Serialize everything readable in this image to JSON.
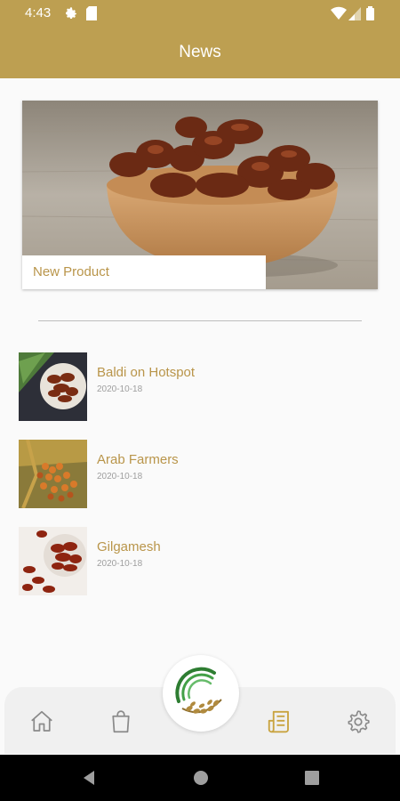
{
  "status_bar": {
    "time": "4:43"
  },
  "app_bar": {
    "title": "News"
  },
  "featured": {
    "caption": "New Product"
  },
  "news": [
    {
      "title": "Baldi on Hotspot",
      "date": "2020-10-18"
    },
    {
      "title": "Arab Farmers",
      "date": "2020-10-18"
    },
    {
      "title": "Gilgamesh",
      "date": "2020-10-18"
    }
  ],
  "bottom_nav": {
    "items": [
      "home-icon",
      "shopping-bag-icon",
      "news-icon",
      "settings-icon"
    ],
    "active": "news-icon",
    "center": "logo-icon"
  },
  "colors": {
    "brand": "#bd9f51",
    "accent_text": "#b9954a",
    "date_text": "#9e9e9e",
    "nav_inactive": "#8a8a8a",
    "nav_active": "#c9a441"
  }
}
